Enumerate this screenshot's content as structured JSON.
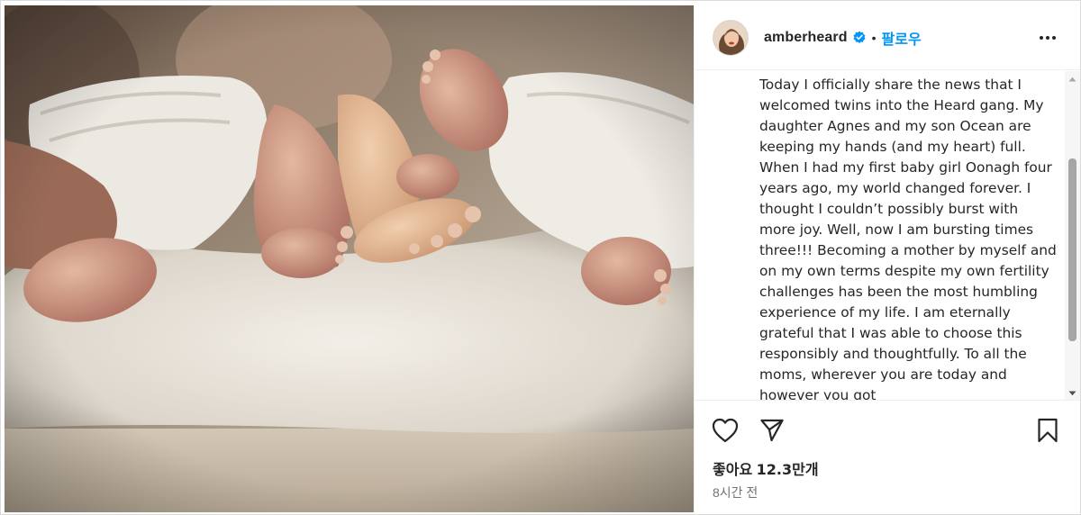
{
  "post": {
    "image_alt": "Newborn twins' feet on a white towel",
    "header": {
      "username": "amberheard",
      "verified_icon": "verified-badge-icon",
      "separator": "•",
      "follow_label": "팔로우",
      "more_icon": "more-options-icon"
    },
    "caption": "Today I officially share the news that I welcomed twins into the Heard gang. My daughter Agnes and my son Ocean are keeping my hands (and my heart) full. When I had my first baby girl Oonagh four years ago, my world changed forever. I thought I couldn’t possibly burst with more joy. Well, now I am bursting times three!!! Becoming a mother by myself and on my own terms despite my own fertility challenges has been the most humbling experience of my life. I am eternally grateful that I was able to choose this responsibly and thoughtfully. To all the moms, wherever you are today and however you got",
    "actions": {
      "like_icon": "heart-icon",
      "share_icon": "send-icon",
      "save_icon": "bookmark-icon"
    },
    "likes_label": "좋아요",
    "likes_count": "12.3만개",
    "time_ago": "8시간 전"
  },
  "colors": {
    "accent": "#0095f6",
    "verified": "#0095f6",
    "text": "#262626",
    "muted": "#737373"
  }
}
